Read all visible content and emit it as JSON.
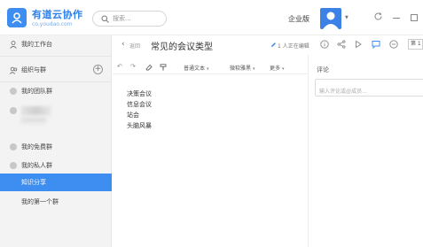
{
  "app": {
    "name": "有道云协作",
    "url": "co.youdao.com"
  },
  "topbar": {
    "search_placeholder": "搜索...",
    "enterprise_label": "企业版"
  },
  "sidebar": {
    "workbench_label": "我的工作台",
    "groups_label": "组织与群",
    "items": [
      {
        "label": "我的团队群"
      },
      {
        "label": "我的免费群"
      },
      {
        "label": "我的私人群"
      }
    ],
    "children": [
      {
        "label": "知识分享",
        "active": true
      },
      {
        "label": "我的第一个群",
        "active": false
      }
    ]
  },
  "document": {
    "back_label": "返回",
    "title": "常见的会议类型",
    "editing_status": "1 人正在编辑",
    "page_label": "第 1",
    "toolbar": {
      "style_label": "普通文本",
      "font_label": "微软雅黑",
      "more_label": "更多"
    },
    "lines": [
      "决策会议",
      "信息会议",
      "站会",
      "头脑风暴"
    ]
  },
  "comments": {
    "title": "评论",
    "placeholder": "输入评论或@成员…"
  },
  "colors": {
    "accent": "#3d8ef0",
    "sidebar_bg": "#f3f3f3"
  }
}
